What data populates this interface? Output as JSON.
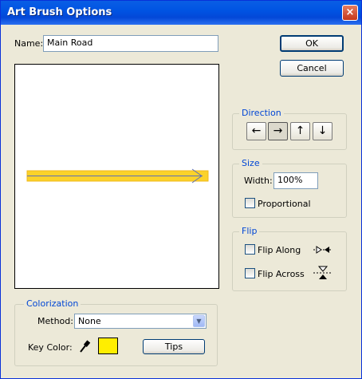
{
  "window": {
    "title": "Art Brush Options",
    "close_glyph": "×"
  },
  "name_field": {
    "label": "Name:",
    "value": "Main Road"
  },
  "buttons": {
    "ok": "OK",
    "cancel": "Cancel",
    "tips": "Tips"
  },
  "direction": {
    "title": "Direction",
    "arrows": [
      {
        "icon": "arrow-left-icon",
        "glyph": "←",
        "selected": false
      },
      {
        "icon": "arrow-right-icon",
        "glyph": "→",
        "selected": true
      },
      {
        "icon": "arrow-up-icon",
        "glyph": "↑",
        "selected": false
      },
      {
        "icon": "arrow-down-icon",
        "glyph": "↓",
        "selected": false
      }
    ]
  },
  "size": {
    "title": "Size",
    "width_label": "Width:",
    "width_value": "100%",
    "proportional_label": "Proportional",
    "proportional_checked": false
  },
  "flip": {
    "title": "Flip",
    "along_label": "Flip Along",
    "along_checked": false,
    "across_label": "Flip Across",
    "across_checked": false
  },
  "colorization": {
    "title": "Colorization",
    "method_label": "Method:",
    "method_value": "None",
    "key_color_label": "Key Color:",
    "key_color": "#ffee00"
  },
  "preview": {
    "brush_color": "#fbd22a",
    "brush_edge": "#f2b81a",
    "stroke_color": "#5b6fb8"
  }
}
